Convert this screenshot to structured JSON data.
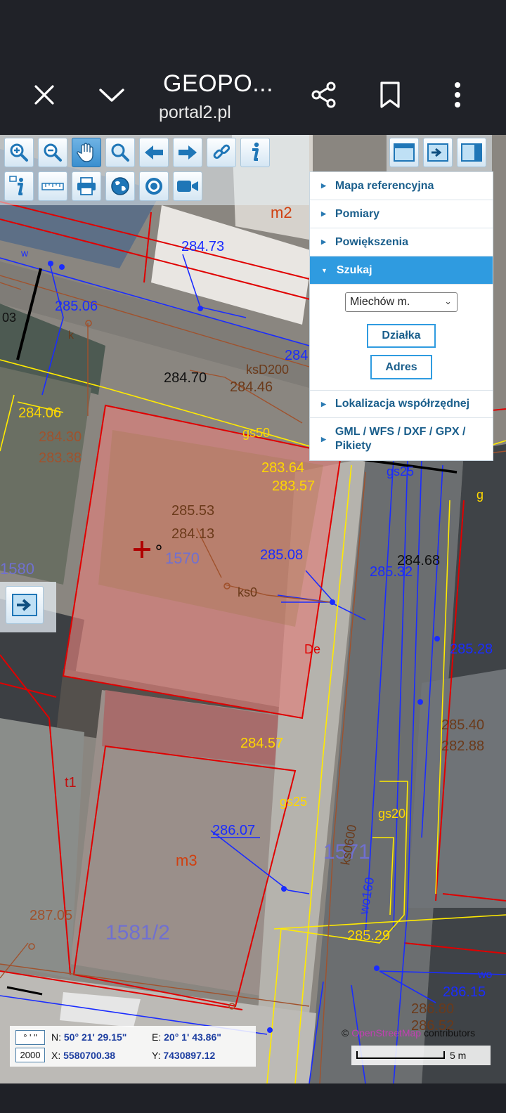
{
  "browser": {
    "title": "GEOPO...",
    "url": "portal2.pl",
    "icons": [
      "close-icon",
      "chevron-down-icon",
      "share-icon",
      "bookmark-icon",
      "more-vert-icon"
    ]
  },
  "toolbar": {
    "tools": [
      "zoom-in-icon",
      "zoom-out-icon",
      "pan-hand-icon",
      "zoom-box-icon",
      "back-icon",
      "forward-icon",
      "link-icon",
      "info-icon",
      "info-alt-icon",
      "ruler-icon",
      "print-icon",
      "globe-icon",
      "target-icon",
      "camera-icon"
    ],
    "active": "pan-hand-icon"
  },
  "panel": {
    "items": [
      {
        "label": "Mapa referencyjna"
      },
      {
        "label": "Pomiary"
      },
      {
        "label": "Powiększenia"
      },
      {
        "label": "Szukaj"
      },
      {
        "label": "Lokalizacja współrzędnej"
      },
      {
        "label": "GML / WFS / DXF / GPX / Pikiety"
      }
    ],
    "selected": "Szukaj",
    "search": {
      "select_value": "Miechów m.",
      "btn_parcel": "Działka",
      "btn_address": "Adres"
    }
  },
  "map": {
    "labels": {
      "m2": "m2",
      "m3": "m3",
      "t1": "t1",
      "e1": "284.73",
      "e2": "285.06",
      "e3": "284.70",
      "e4": "284.46",
      "e5": "284.06",
      "e6": "283.64",
      "e7": "283.57",
      "e8": "285.53",
      "e9": "284.13",
      "e10": "285.08",
      "e11": "285.32",
      "e12": "284.68",
      "e13": "285.28",
      "e14": "285.40",
      "e15": "282.88",
      "e16": "284.57",
      "e17": "286.07",
      "e18": "287.05",
      "e19": "285.29",
      "e20": "286.15",
      "e21": "286.80",
      "e22": "286.52",
      "e23": "284",
      "p1": "1570",
      "p2": "1571",
      "p3": "1581/2",
      "p4": "1580",
      "pipe1": "ksD200",
      "pipe2": "gs50",
      "pipe3": "ks0",
      "pipe4": "gs25",
      "pipe5": "gs20",
      "pipe6": "ks0600",
      "pipe7": "wo160",
      "pipe8": "gs25",
      "pipe9": "wo",
      "w": "w",
      "k": "k",
      "g": "g",
      "De": "De",
      "i03": "03",
      "lbl_284_30": "284.30",
      "lbl_283_38": "283.38"
    }
  },
  "coordinates": {
    "dms_box": "° ' \"",
    "epsg_box": "2000",
    "n_label": "N:",
    "n_value": "50° 21' 29.15\"",
    "e_label": "E:",
    "e_value": "20° 1' 43.86\"",
    "x_label": "X:",
    "x_value": "5580700.38",
    "y_label": "Y:",
    "y_value": "7430897.12"
  },
  "attribution": {
    "copy": "©",
    "osm": "OpenStreetMap",
    "rest": " contributors"
  },
  "scale": {
    "label": "5 m"
  },
  "colors": {
    "accent": "#2f9be0",
    "panel_text": "#1b5f8c",
    "parcel_fill": "#e0807b",
    "boundary": "#e00000",
    "water": "#1a2cff",
    "gas": "#ffea00",
    "sewer": "#a0522d"
  }
}
